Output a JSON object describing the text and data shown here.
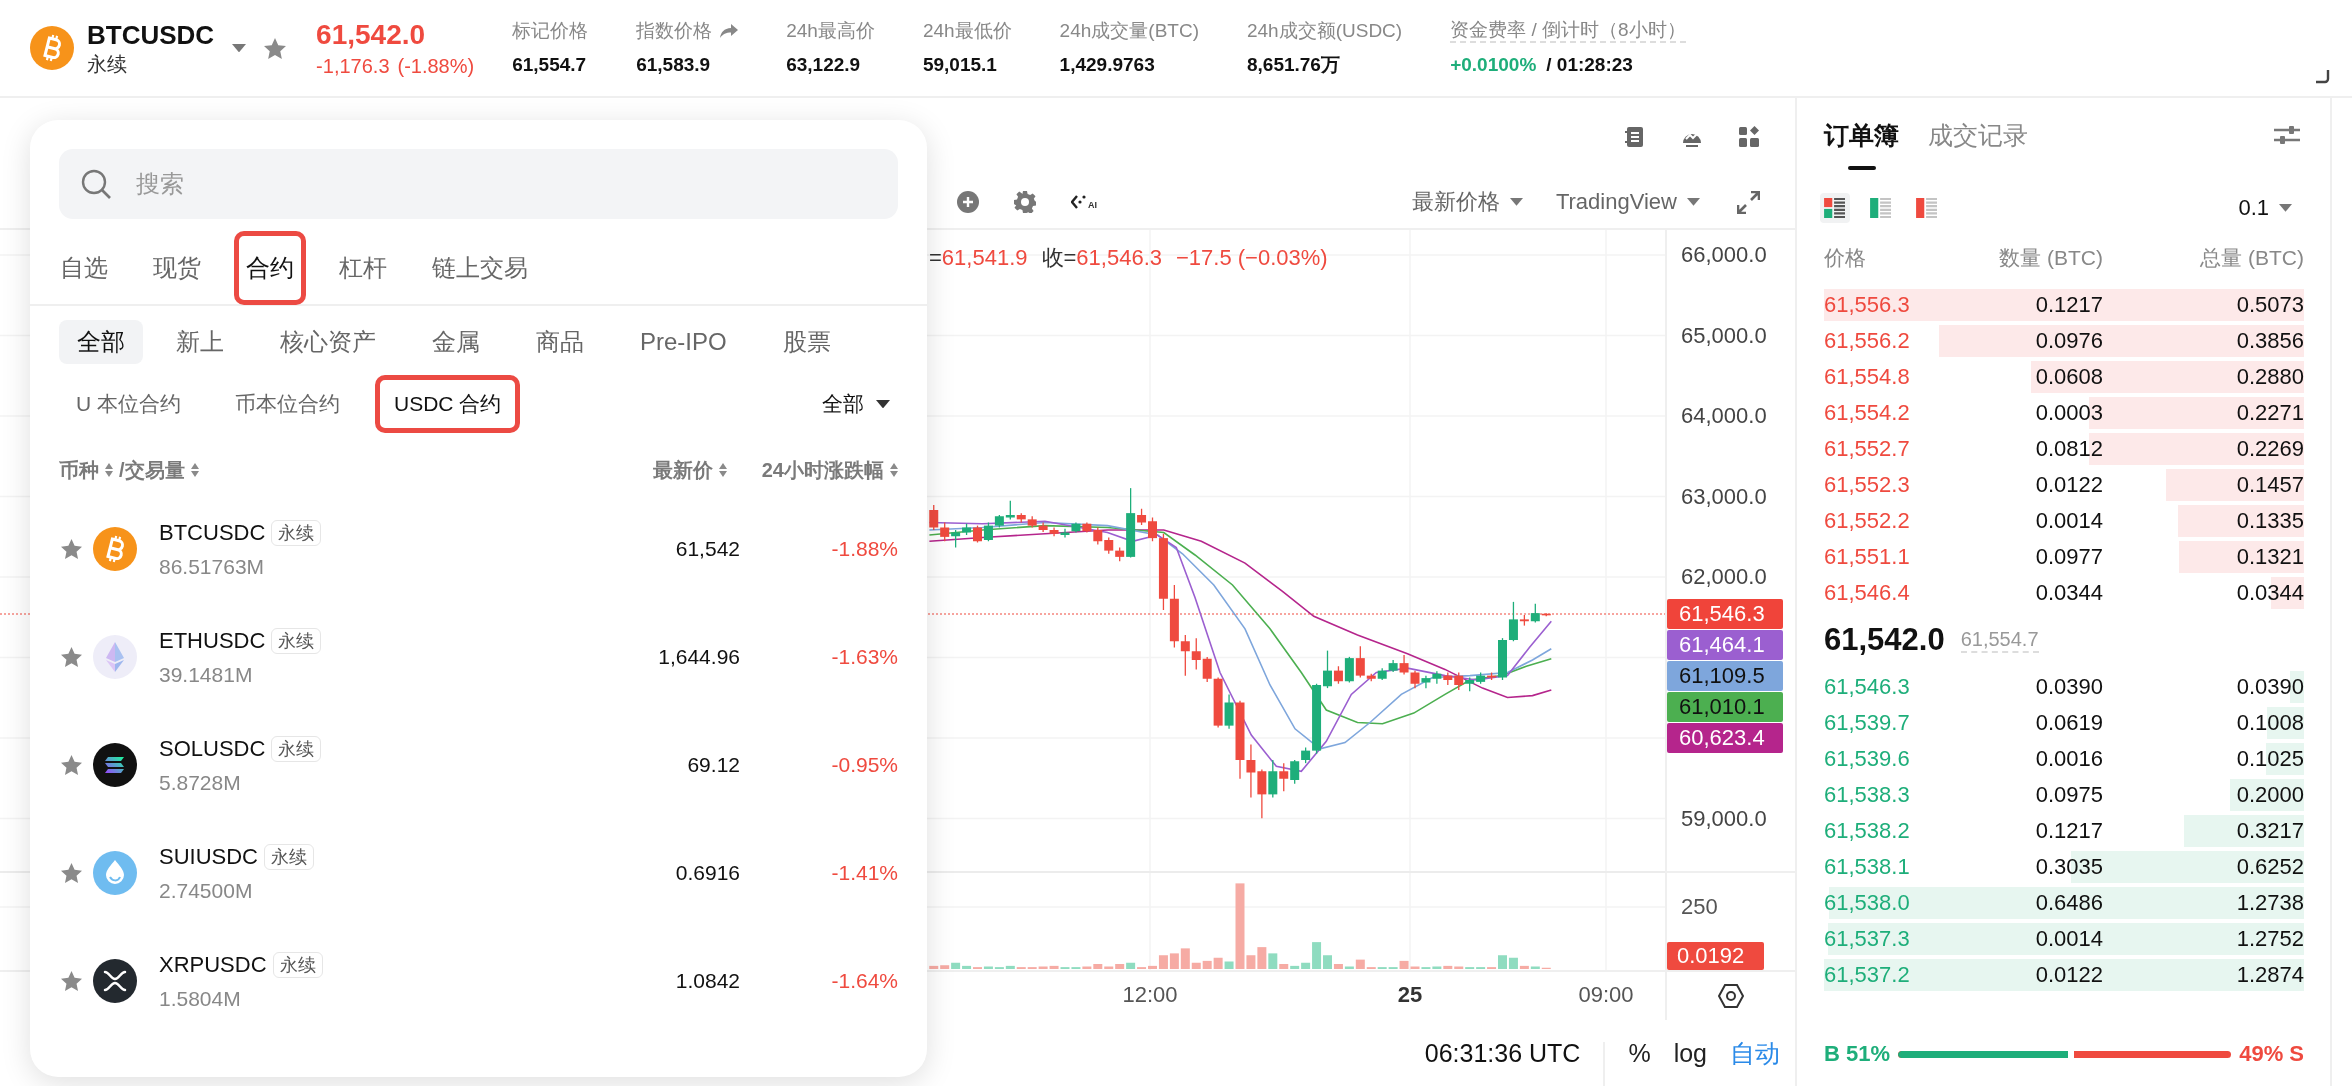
{
  "header": {
    "symbol": "BTCUSDC",
    "contract_type": "永续",
    "favorite": false,
    "last_price": "61,542.0",
    "change": "-1,176.3",
    "change_pct": "(-1.88%)",
    "stats": [
      {
        "label": "标记价格",
        "value": "61,554.7",
        "kind": "plain"
      },
      {
        "label": "指数价格",
        "value": "61,583.9",
        "kind": "link"
      },
      {
        "label": "24h最高价",
        "value": "63,122.9",
        "kind": "plain"
      },
      {
        "label": "24h最低价",
        "value": "59,015.1",
        "kind": "plain"
      },
      {
        "label": "24h成交量(BTC)",
        "value": "1,429.9763",
        "kind": "plain"
      },
      {
        "label": "24h成交额(USDC)",
        "value": "8,651.76万",
        "kind": "plain"
      }
    ],
    "funding": {
      "label": "资金费率 / 倒计时（8小时）",
      "rate": "+0.0100%",
      "countdown": "/ 01:28:23"
    }
  },
  "market_panel": {
    "search": {
      "placeholder": "搜索"
    },
    "tabs": [
      {
        "label": "自选",
        "selected": false,
        "highlighted": false
      },
      {
        "label": "现货",
        "selected": false,
        "highlighted": false
      },
      {
        "label": "合约",
        "selected": true,
        "highlighted": true
      },
      {
        "label": "杠杆",
        "selected": false,
        "highlighted": false
      },
      {
        "label": "链上交易",
        "selected": false,
        "highlighted": false
      }
    ],
    "categories": [
      {
        "label": "全部",
        "selected": true
      },
      {
        "label": "新上",
        "selected": false
      },
      {
        "label": "核心资产",
        "selected": false
      },
      {
        "label": "金属",
        "selected": false
      },
      {
        "label": "商品",
        "selected": false
      },
      {
        "label": "Pre-IPO",
        "selected": false
      },
      {
        "label": "股票",
        "selected": false
      }
    ],
    "contract_types": [
      {
        "label": "U 本位合约",
        "selected": false,
        "highlighted": false
      },
      {
        "label": "币本位合约",
        "selected": false,
        "highlighted": false
      },
      {
        "label": "USDC 合约",
        "selected": true,
        "highlighted": true
      }
    ],
    "filter": "全部",
    "columns": [
      {
        "labels": [
          "币种",
          "/交易量"
        ]
      },
      {
        "labels": [
          "最新价"
        ]
      },
      {
        "labels": [
          "24小时涨跌幅"
        ]
      }
    ],
    "rows": [
      {
        "kind": "btc",
        "symbol": "BTCUSDC",
        "tag": "永续",
        "volume": "86.51763M",
        "price": "61,542",
        "change": "-1.88%",
        "favorite": false
      },
      {
        "kind": "eth",
        "symbol": "ETHUSDC",
        "tag": "永续",
        "volume": "39.1481M",
        "price": "1,644.96",
        "change": "-1.63%",
        "favorite": false
      },
      {
        "kind": "sol",
        "symbol": "SOLUSDC",
        "tag": "永续",
        "volume": "5.8728M",
        "price": "69.12",
        "change": "-0.95%",
        "favorite": false
      },
      {
        "kind": "sui",
        "symbol": "SUIUSDC",
        "tag": "永续",
        "volume": "2.74500M",
        "price": "0.6916",
        "change": "-1.41%",
        "favorite": false
      },
      {
        "kind": "xrp",
        "symbol": "XRPUSDC",
        "tag": "永续",
        "volume": "1.5804M",
        "price": "1.0842",
        "change": "-1.64%",
        "favorite": false
      }
    ]
  },
  "chart": {
    "ai_label": "AI",
    "price_source": "最新价格",
    "chart_type": "TradingView",
    "legend": [
      {
        "label": "=",
        "value": "61,541.9"
      },
      {
        "label": "收=",
        "value": "61,546.3"
      },
      {
        "value": "−17.5 (−0.03%)"
      }
    ],
    "price_axis": [
      "66,000.0",
      "65,000.0",
      "64,000.0",
      "63,000.0",
      "62,000.0",
      "59,000.0"
    ],
    "price_tags": [
      {
        "value": "61,546.3",
        "color": "#f0443a"
      },
      {
        "value": "61,464.1",
        "color": "#9b5fd0"
      },
      {
        "value": "61,109.5",
        "color": "#7ea6dc"
      },
      {
        "value": "61,010.1",
        "color": "#4caf50"
      },
      {
        "value": "60,623.4",
        "color": "#b5258c"
      }
    ],
    "volume_axis": "250",
    "volume_tag": "0.0192",
    "time_axis": [
      {
        "label": "12:00",
        "kind": "time"
      },
      {
        "label": "25",
        "kind": "day"
      },
      {
        "label": "09:00",
        "kind": "time"
      }
    ],
    "clock": "06:31:36 UTC",
    "scale_buttons": [
      {
        "label": "%",
        "selected": false
      },
      {
        "label": "log",
        "selected": false
      },
      {
        "label": "自动",
        "selected": true
      }
    ]
  },
  "order_book": {
    "tabs": [
      {
        "label": "订单簿",
        "selected": true
      },
      {
        "label": "成交记录",
        "selected": false
      }
    ],
    "views": [
      {
        "kind": "both",
        "selected": true
      },
      {
        "kind": "bids",
        "selected": false
      },
      {
        "kind": "asks",
        "selected": false
      }
    ],
    "tick_size": "0.1",
    "columns": [
      "价格",
      "数量 (BTC)",
      "总量 (BTC)"
    ],
    "asks": [
      {
        "price": "61,556.3",
        "amount": "0.1217",
        "total": "0.5073",
        "level": 1.0
      },
      {
        "price": "61,556.2",
        "amount": "0.0976",
        "total": "0.3856",
        "level": 0.76
      },
      {
        "price": "61,554.8",
        "amount": "0.0608",
        "total": "0.2880",
        "level": 0.568
      },
      {
        "price": "61,554.2",
        "amount": "0.0003",
        "total": "0.2271",
        "level": 0.448
      },
      {
        "price": "61,552.7",
        "amount": "0.0812",
        "total": "0.2269",
        "level": 0.447
      },
      {
        "price": "61,552.3",
        "amount": "0.0122",
        "total": "0.1457",
        "level": 0.287
      },
      {
        "price": "61,552.2",
        "amount": "0.0014",
        "total": "0.1335",
        "level": 0.263
      },
      {
        "price": "61,551.1",
        "amount": "0.0977",
        "total": "0.1321",
        "level": 0.26
      },
      {
        "price": "61,546.4",
        "amount": "0.0344",
        "total": "0.0344",
        "level": 0.068
      }
    ],
    "last_price": "61,542.0",
    "mark_price": "61,554.7",
    "bids": [
      {
        "price": "61,546.3",
        "amount": "0.0390",
        "total": "0.0390",
        "level": 0.03
      },
      {
        "price": "61,539.7",
        "amount": "0.0619",
        "total": "0.1008",
        "level": 0.078
      },
      {
        "price": "61,539.6",
        "amount": "0.0016",
        "total": "0.1025",
        "level": 0.08
      },
      {
        "price": "61,538.3",
        "amount": "0.0975",
        "total": "0.2000",
        "level": 0.155
      },
      {
        "price": "61,538.2",
        "amount": "0.1217",
        "total": "0.3217",
        "level": 0.25
      },
      {
        "price": "61,538.1",
        "amount": "0.3035",
        "total": "0.6252",
        "level": 0.486
      },
      {
        "price": "61,538.0",
        "amount": "0.6486",
        "total": "1.2738",
        "level": 0.989
      },
      {
        "price": "61,537.3",
        "amount": "0.0014",
        "total": "1.2752",
        "level": 0.991
      },
      {
        "price": "61,537.2",
        "amount": "0.0122",
        "total": "1.2874",
        "level": 1.0
      }
    ],
    "ratio": {
      "buy": "B 51%",
      "sell": "49% S",
      "level": 0.51
    }
  }
}
